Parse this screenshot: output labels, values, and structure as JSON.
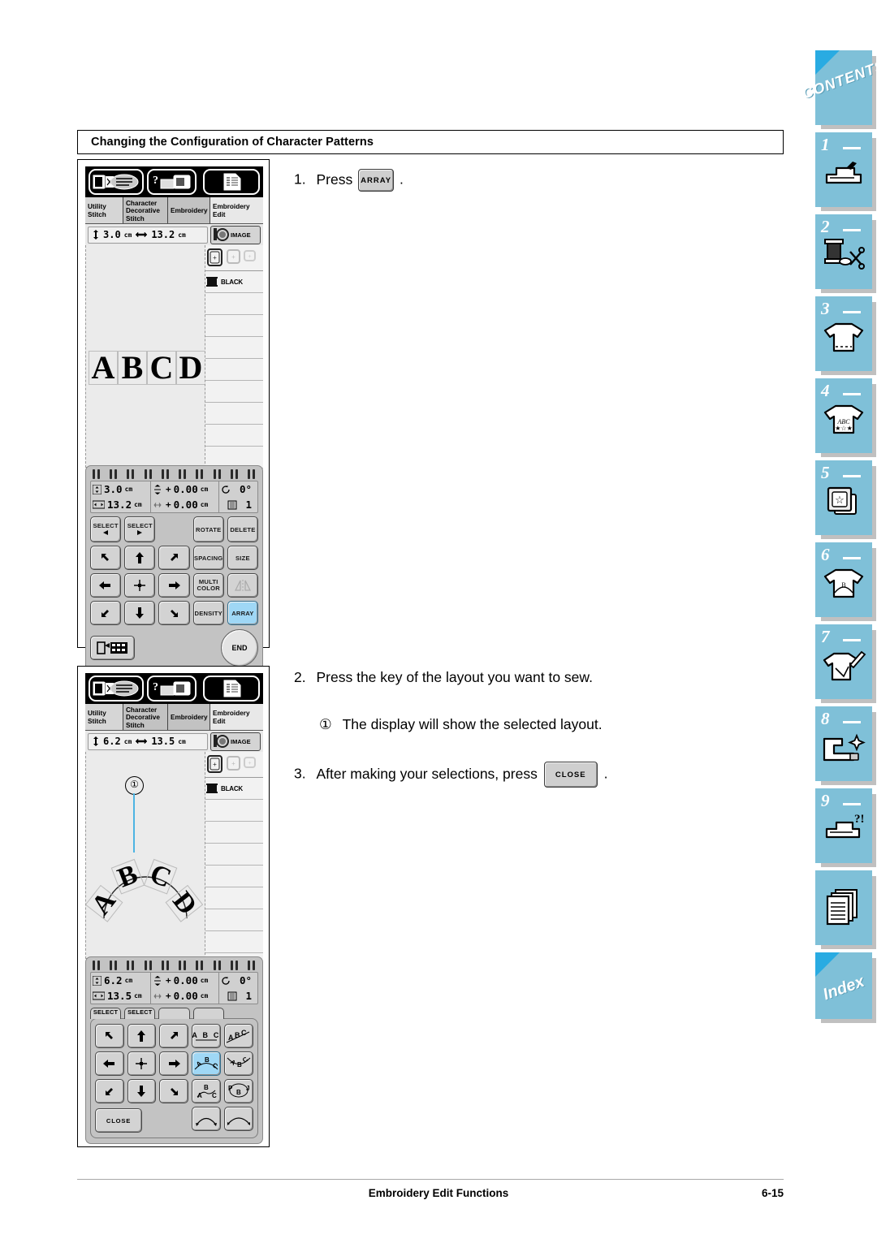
{
  "heading": "Changing the Configuration of Character Patterns",
  "footer": {
    "title": "Embroidery Edit Functions",
    "page": "6-15"
  },
  "instructions": {
    "step1": {
      "num": "1.",
      "pre": "Press",
      "key": "ARRAY",
      "post": "."
    },
    "step2": {
      "num": "2.",
      "text": "Press the key of the layout you want to sew."
    },
    "step2note": {
      "marker": "①",
      "text": "The display will show the selected layout."
    },
    "step3": {
      "num": "3.",
      "pre": "After making your selections, press",
      "key": "CLOSE",
      "post": "."
    }
  },
  "screen1": {
    "tabs": [
      {
        "label": "Utility\nStitch"
      },
      {
        "label": "Character\nDecorative\nStitch"
      },
      {
        "label": "Embroidery"
      },
      {
        "label": "Embroidery\nEdit"
      }
    ],
    "size": {
      "height": "3.0",
      "width": "13.2",
      "unit": "cm"
    },
    "image_button": "IMAGE",
    "thread_color": "BLACK",
    "pattern_text": [
      "A",
      "B",
      "C",
      "D"
    ],
    "readout": {
      "size_h": "3.0",
      "size_w": "13.2",
      "unit": "cm",
      "off_v": "0.00",
      "off_h": "0.00",
      "rotation": "0°",
      "density": "1"
    },
    "keys": [
      "SELECT",
      "SELECT",
      "ROTATE",
      "DELETE",
      "SPACING",
      "SIZE",
      "MULTI COLOR",
      "DENSITY",
      "ARRAY",
      "END"
    ],
    "key_labels": {
      "select_left": "SELECT",
      "select_right": "SELECT",
      "rotate": "ROTATE",
      "delete": "DELETE",
      "spacing": "SPACING",
      "size": "SIZE",
      "multi": "MULTI",
      "color": "COLOR",
      "mirror": "",
      "density": "DENSITY",
      "array": "ARRAY",
      "end": "END"
    },
    "selected_key": "ARRAY"
  },
  "screen2": {
    "tabs": [
      {
        "label": "Utility\nStitch"
      },
      {
        "label": "Character\nDecorative\nStitch"
      },
      {
        "label": "Embroidery"
      },
      {
        "label": "Embroidery\nEdit"
      }
    ],
    "size": {
      "height": "6.2",
      "width": "13.5",
      "unit": "cm"
    },
    "image_button": "IMAGE",
    "thread_color": "BLACK",
    "pattern_text": [
      "A",
      "B",
      "C",
      "D"
    ],
    "callout": "①",
    "readout": {
      "size_h": "6.2",
      "size_w": "13.5",
      "unit": "cm",
      "off_v": "0.00",
      "off_h": "0.00",
      "rotation": "0°",
      "density": "1"
    },
    "stub_labels": [
      "SELECT",
      "SELECT",
      "",
      "",
      ""
    ],
    "layout_keys": [
      {
        "name": "straight",
        "label": "A B C"
      },
      {
        "name": "slanted",
        "label": "ABC"
      },
      {
        "name": "arc-up",
        "label": "ABC",
        "selected": true
      },
      {
        "name": "arc-down",
        "label": "ABC"
      },
      {
        "name": "wave",
        "label": "B"
      },
      {
        "name": "circle",
        "label": "B"
      },
      {
        "name": "arc-narrow",
        "label": ""
      },
      {
        "name": "arc-wide",
        "label": ""
      }
    ],
    "close_label": "CLOSE"
  },
  "index_tabs": [
    {
      "id": "contents",
      "label": "CONTENTS",
      "num": "",
      "icon": "contents-corner"
    },
    {
      "id": "ch1",
      "label": "",
      "num": "1",
      "icon": "sewing-machine-icon"
    },
    {
      "id": "ch2",
      "label": "",
      "num": "2",
      "icon": "spool-scissors-icon"
    },
    {
      "id": "ch3",
      "label": "",
      "num": "3",
      "icon": "tshirt-icon"
    },
    {
      "id": "ch4",
      "label": "",
      "num": "4",
      "icon": "tshirt-abc-icon"
    },
    {
      "id": "ch5",
      "label": "",
      "num": "5",
      "icon": "card-star-icon"
    },
    {
      "id": "ch6",
      "label": "",
      "num": "6",
      "icon": "tshirt-arc-icon"
    },
    {
      "id": "ch7",
      "label": "",
      "num": "7",
      "icon": "tshirt-pencil-icon"
    },
    {
      "id": "ch8",
      "label": "",
      "num": "8",
      "icon": "machine-sparkle-icon"
    },
    {
      "id": "ch9",
      "label": "",
      "num": "9",
      "icon": "machine-question-icon"
    },
    {
      "id": "appendix",
      "label": "",
      "num": "",
      "icon": "pages-icon"
    },
    {
      "id": "index",
      "label": "Index",
      "num": "",
      "icon": "index-corner"
    }
  ],
  "colors": {
    "tab_blue": "#7fc0d8",
    "corner_blue": "#29abe2",
    "selected_key": "#9fd7f5",
    "callout_line": "#4db4e3"
  }
}
